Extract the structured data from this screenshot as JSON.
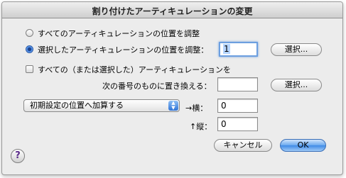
{
  "window": {
    "title": "割り付けたアーティキュレーションの変更"
  },
  "options": {
    "radio_all_label": "すべてのアーティキュレーションの位置を調整",
    "radio_selected_label": "選択したアーティキュレーションの位置を調整：",
    "selected_value": "1",
    "select_button_1": "選択...",
    "checkbox_replace_label": "すべての（または選択した）アーティキュレーションを",
    "replace_with_label": "次の番号のものに置き換える：",
    "replace_value": "",
    "select_button_2": "選択..."
  },
  "position": {
    "popup_value": "初期設定の位置へ加算する",
    "horizontal_label": "→横：",
    "horizontal_value": "0",
    "vertical_label": "↑縦：",
    "vertical_value": "0"
  },
  "footer": {
    "help_glyph": "?",
    "cancel_label": "キャンセル",
    "ok_label": "OK"
  },
  "colors": {
    "dialog_bg": "#ececec",
    "default_button": "#3f8ae6",
    "focus_ring": "#6c9fe0"
  },
  "icons": {
    "popup_arrows": "up-down-arrows-icon",
    "help": "help-icon"
  }
}
